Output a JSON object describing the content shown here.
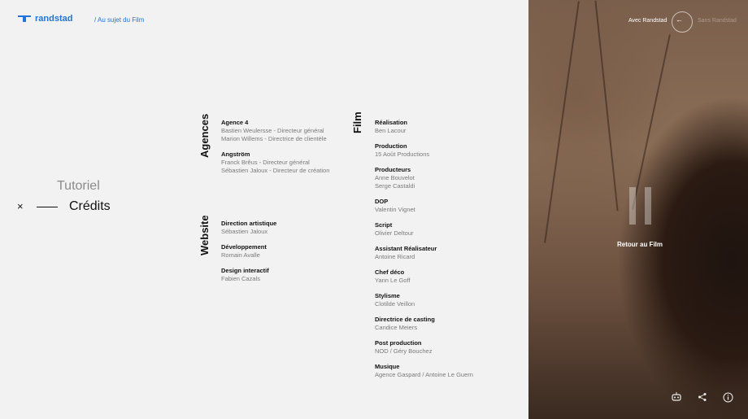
{
  "header": {
    "logo_text": "randstad",
    "breadcrumb": "/ Au sujet du Film"
  },
  "menu": {
    "tutoriel": "Tutoriel",
    "credits": "Crédits",
    "close": "×"
  },
  "sections": {
    "agences": {
      "heading": "Agences",
      "groups": [
        {
          "title": "Agence 4",
          "lines": [
            "Bastien Weulersse - Directeur général",
            "Marion Willems - Directrice de clientèle"
          ]
        },
        {
          "title": "Angström",
          "lines": [
            "Franck Brêus - Directeur général",
            "Sébastien Jaloux - Directeur de création"
          ]
        }
      ]
    },
    "website": {
      "heading": "Website",
      "groups": [
        {
          "title": "Direction artistique",
          "lines": [
            "Sébastien Jaloux"
          ]
        },
        {
          "title": "Développement",
          "lines": [
            "Romain Avalle"
          ]
        },
        {
          "title": "Design interactif",
          "lines": [
            "Fabien Cazals"
          ]
        }
      ]
    },
    "film": {
      "heading": "Film",
      "groups": [
        {
          "title": "Réalisation",
          "lines": [
            "Ben Lacour"
          ]
        },
        {
          "title": "Production",
          "lines": [
            "15 Août Productions"
          ]
        },
        {
          "title": "Producteurs",
          "lines": [
            "Anne Bouvelot",
            "Serge Castaldi"
          ]
        },
        {
          "title": "DOP",
          "lines": [
            "Valentin Vignet"
          ]
        },
        {
          "title": "Script",
          "lines": [
            "Olivier Deltour"
          ]
        },
        {
          "title": "Assistant Réalisateur",
          "lines": [
            "Antoine Ricard"
          ]
        },
        {
          "title": "Chef déco",
          "lines": [
            "Yann Le Goff"
          ]
        },
        {
          "title": "Stylisme",
          "lines": [
            "Clotilde Veillon"
          ]
        },
        {
          "title": "Directrice de casting",
          "lines": [
            "Candice Meiers"
          ]
        },
        {
          "title": "Post production",
          "lines": [
            "NOD / Géry Bouchez"
          ]
        },
        {
          "title": "Musique",
          "lines": [
            "Agence Gaspard / Antoine Le Guern"
          ]
        }
      ]
    }
  },
  "video": {
    "toggle_on": "Avec Randstad",
    "toggle_off": "Sans Randstad",
    "retour": "Retour au Film",
    "icons": [
      "robot-icon",
      "share-icon",
      "info-icon"
    ]
  },
  "colors": {
    "brand": "#2175d9",
    "background": "#f2f2f2"
  }
}
